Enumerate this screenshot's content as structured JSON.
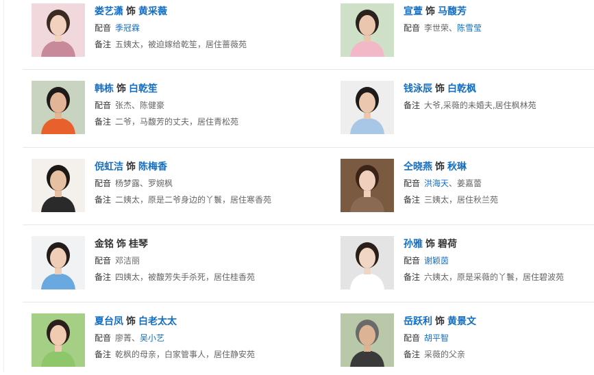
{
  "labels": {
    "shi": "饰",
    "dub": "配音",
    "note": "备注",
    "sep": "、"
  },
  "colors": {
    "link": "#136ec2",
    "text": "#333333",
    "muted": "#666666",
    "rule": "#e8e8e8"
  },
  "cast": [
    {
      "actor": "娄艺潇",
      "role": "黄采薇",
      "actor_link": true,
      "role_link": true,
      "dub": [
        {
          "text": "季冠霖",
          "link": true
        }
      ],
      "note": "五姨太，被迫嫁给乾笙，居住蔷薇苑"
    },
    {
      "actor": "宣萱",
      "role": "马馥芳",
      "actor_link": true,
      "role_link": true,
      "dub": [
        {
          "text": "李世荣",
          "link": false
        },
        {
          "text": "陈雪莹",
          "link": true
        }
      ],
      "note": ""
    },
    {
      "actor": "韩栋",
      "role": "白乾笙",
      "actor_link": true,
      "role_link": true,
      "dub": [
        {
          "text": "张杰",
          "link": false
        },
        {
          "text": "陈健豪",
          "link": false
        }
      ],
      "note": "二爷，马馥芳的丈夫，居住青松苑"
    },
    {
      "actor": "钱泳辰",
      "role": "白乾枫",
      "actor_link": true,
      "role_link": true,
      "dub": [],
      "note": "大爷,采薇的未婚夫,居住枫林苑"
    },
    {
      "actor": "倪虹洁",
      "role": "陈梅香",
      "actor_link": true,
      "role_link": true,
      "dub": [
        {
          "text": "杨梦露",
          "link": false
        },
        {
          "text": "罗婉枫",
          "link": false
        }
      ],
      "note": "二姨太，原是二爷身边的丫鬟，居住寒香苑"
    },
    {
      "actor": "仝晓燕",
      "role": "秋琳",
      "actor_link": true,
      "role_link": true,
      "dub": [
        {
          "text": "洪海天",
          "link": true
        },
        {
          "text": "姜嘉蕾",
          "link": false
        }
      ],
      "note": "三姨太，居住秋兰苑"
    },
    {
      "actor": "金铭",
      "role": "桂琴",
      "actor_link": false,
      "role_link": false,
      "dub": [
        {
          "text": "邓洁丽",
          "link": false
        }
      ],
      "note": "四姨太，被馥芳失手杀死，居住桂香苑"
    },
    {
      "actor": "孙雅",
      "role": "碧荷",
      "actor_link": true,
      "role_link": false,
      "dub": [
        {
          "text": "谢颖茵",
          "link": true
        }
      ],
      "note": "六姨太，原是采薇的丫鬟，居住碧波苑"
    },
    {
      "actor": "夏台凤",
      "role": "白老太太",
      "actor_link": true,
      "role_link": true,
      "dub": [
        {
          "text": "廖菁",
          "link": false
        },
        {
          "text": "吴小艺",
          "link": true
        }
      ],
      "note": "乾枫的母亲，白家管事人，居住静安苑"
    },
    {
      "actor": "岳跃利",
      "role": "黄景文",
      "actor_link": true,
      "role_link": true,
      "dub": [
        {
          "text": "胡平智",
          "link": true
        }
      ],
      "note": "采薇的父亲"
    }
  ]
}
